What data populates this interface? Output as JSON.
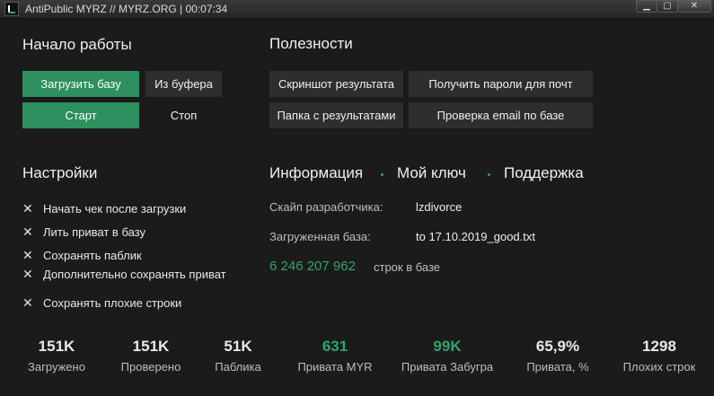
{
  "window": {
    "title": "AntiPublic MYRZ // MYRZ.ORG | 00:07:34",
    "minimize": "▁",
    "maximize": "▢",
    "close": "✕"
  },
  "start": {
    "heading": "Начало работы",
    "load_base": "Загрузить базу",
    "from_buffer": "Из буфера",
    "start": "Старт",
    "stop": "Стоп"
  },
  "utilities": {
    "heading": "Полезности",
    "screenshot": "Скриншот результата",
    "get_passwords": "Получить пароли для почт",
    "results_folder": "Папка с результатами",
    "check_email": "Проверка email по базе"
  },
  "settings": {
    "heading": "Настройки",
    "options": [
      "Начать чек после загрузки",
      "Лить приват в базу",
      "Сохранять паблик",
      "Дополнительно сохранять приват",
      "Сохранять плохие строки"
    ]
  },
  "info": {
    "tabs": [
      "Информация",
      "Мой ключ",
      "Поддержка"
    ],
    "skype_label": "Скайп разработчика:",
    "skype_value": "lzdivorce",
    "base_label": "Загруженная база:",
    "base_value": "to 17.10.2019_good.txt",
    "lines_count": "6 246 207 962",
    "lines_label": "строк в базе"
  },
  "stats": [
    {
      "value": "151K",
      "label": "Загружено"
    },
    {
      "value": "151K",
      "label": "Проверено"
    },
    {
      "value": "51K",
      "label": "Паблика"
    },
    {
      "value": "631",
      "label": "Привата MYR"
    },
    {
      "value": "99K",
      "label": "Привата Забугра"
    },
    {
      "value": "65,9%",
      "label": "Привата, %"
    },
    {
      "value": "1298",
      "label": "Плохих строк"
    }
  ],
  "colors": {
    "accent": "#2fa56a",
    "button_green": "#2e8f5f",
    "background": "#1b1b1b"
  }
}
